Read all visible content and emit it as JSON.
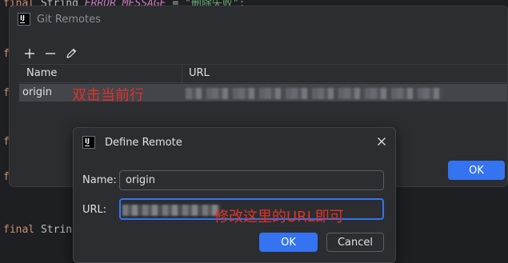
{
  "editor": {
    "top_line": {
      "keyword": "final",
      "type": "String",
      "constant": "ERROR_MESSAGE",
      "op": "=",
      "string": "\"删除失败\";"
    },
    "gutter_char": "f",
    "bottom_line": {
      "keyword": "final",
      "type": "Strin"
    }
  },
  "remotes_window": {
    "title": "Git Remotes",
    "toolbar": {
      "add_icon": "plus-icon",
      "remove_icon": "minus-icon",
      "edit_icon": "pencil-icon"
    },
    "columns": [
      "Name",
      "URL"
    ],
    "rows": [
      {
        "name": "origin",
        "url": ""
      }
    ],
    "row_annotation": "双击当前行",
    "ok_label": "OK"
  },
  "define_remote": {
    "title": "Define Remote",
    "name_label": "Name:",
    "name_value": "origin",
    "url_label": "URL:",
    "url_annotation": "修改这里的URL即可",
    "ok_label": "OK",
    "cancel_label": "Cancel"
  },
  "colors": {
    "accent": "#3574f0",
    "annotation": "#e0322c",
    "background": "#1e1f22",
    "panel": "#2b2d30"
  }
}
